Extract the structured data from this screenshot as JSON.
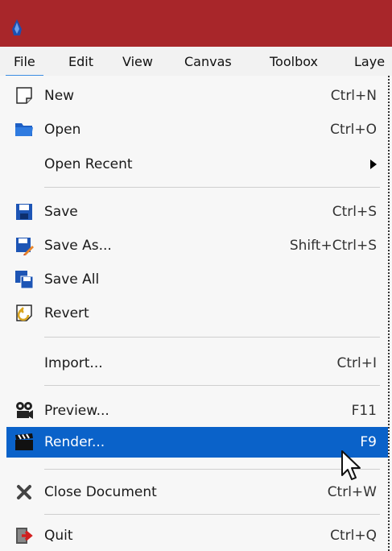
{
  "menubar": {
    "items": [
      "File",
      "Edit",
      "View",
      "Canvas",
      "Toolbox",
      "Laye"
    ],
    "active": "File"
  },
  "file_menu": {
    "new": {
      "label": "New",
      "shortcut": "Ctrl+N",
      "icon": "new-document-icon"
    },
    "open": {
      "label": "Open",
      "shortcut": "Ctrl+O",
      "icon": "folder-open-icon"
    },
    "open_recent": {
      "label": "Open Recent",
      "icon": "submenu-arrow-icon"
    },
    "save": {
      "label": "Save",
      "shortcut": "Ctrl+S",
      "icon": "floppy-disk-icon"
    },
    "save_as": {
      "label": "Save As...",
      "shortcut": "Shift+Ctrl+S",
      "icon": "floppy-disk-pencil-icon"
    },
    "save_all": {
      "label": "Save All",
      "icon": "floppy-disks-icon"
    },
    "revert": {
      "label": "Revert",
      "icon": "revert-icon"
    },
    "import": {
      "label": "Import...",
      "shortcut": "Ctrl+I"
    },
    "preview": {
      "label": "Preview...",
      "shortcut": "F11",
      "icon": "film-camera-icon"
    },
    "render": {
      "label": "Render...",
      "shortcut": "F9",
      "icon": "clapperboard-icon",
      "highlighted": true
    },
    "close_document": {
      "label": "Close Document",
      "shortcut": "Ctrl+W",
      "icon": "close-x-icon"
    },
    "quit": {
      "label": "Quit",
      "shortcut": "Ctrl+Q",
      "icon": "quit-exit-icon"
    }
  },
  "colors": {
    "titlebar": "#a8262a",
    "highlight": "#0a62c9",
    "active_menu_underline": "#3c8de3"
  }
}
